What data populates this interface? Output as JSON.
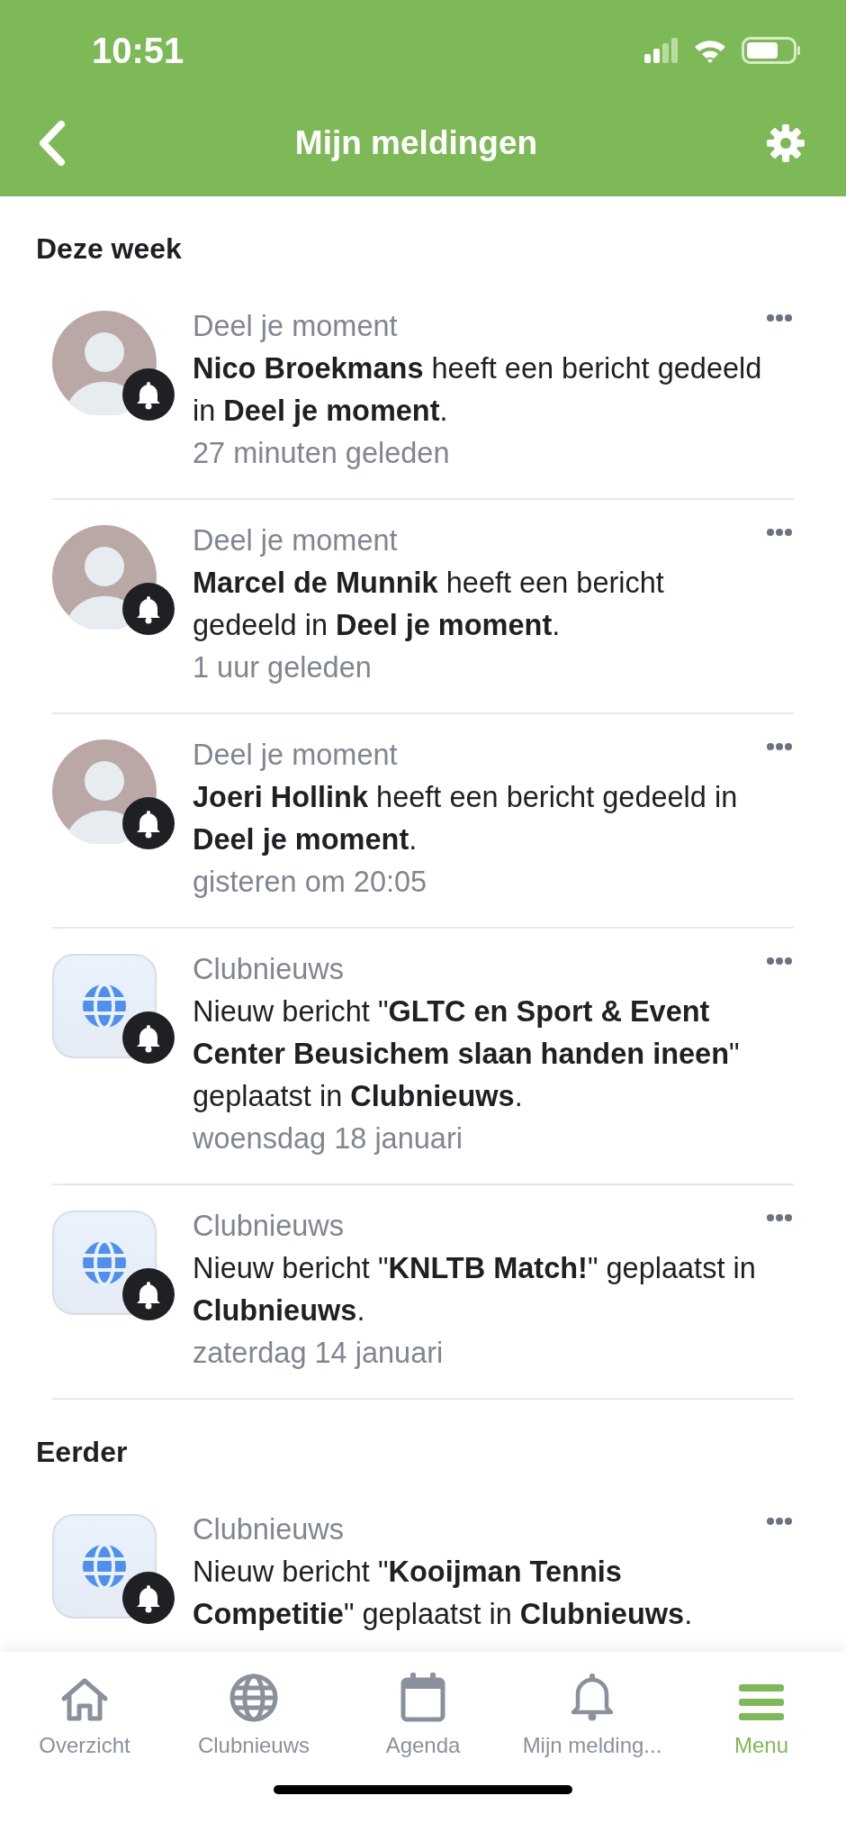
{
  "status_bar": {
    "time": "10:51"
  },
  "nav": {
    "title": "Mijn meldingen"
  },
  "sections": [
    {
      "title": "Deze week",
      "items": [
        {
          "kind": "person",
          "source": "Deel je moment",
          "message": "**Nico Broekmans** heeft een bericht gedeeld in **Deel je moment**.",
          "time": "27 minuten geleden"
        },
        {
          "kind": "person",
          "source": "Deel je moment",
          "message": "**Marcel de Munnik** heeft een bericht gedeeld in **Deel je moment**.",
          "time": "1 uur geleden"
        },
        {
          "kind": "person",
          "source": "Deel je moment",
          "message": "**Joeri Hollink** heeft een bericht gedeeld in **Deel je moment**.",
          "time": "gisteren om 20:05"
        },
        {
          "kind": "club",
          "source": "Clubnieuws",
          "message": "Nieuw bericht \"**GLTC en Sport & Event Center Beusichem slaan handen ineen**\" geplaatst in **Clubnieuws**.",
          "time": "woensdag 18 januari"
        },
        {
          "kind": "club",
          "source": "Clubnieuws",
          "message": "Nieuw bericht \"**KNLTB Match!**\" geplaatst in **Clubnieuws**.",
          "time": "zaterdag 14 januari"
        }
      ]
    },
    {
      "title": "Eerder",
      "items": [
        {
          "kind": "club",
          "source": "Clubnieuws",
          "message": "Nieuw bericht \"**Kooijman Tennis Competitie**\" geplaatst in **Clubnieuws**."
        }
      ]
    }
  ],
  "tabs": [
    {
      "label": "Overzicht",
      "selected": false
    },
    {
      "label": "Clubnieuws",
      "selected": false
    },
    {
      "label": "Agenda",
      "selected": false
    },
    {
      "label": "Mijn melding...",
      "selected": false
    },
    {
      "label": "Menu",
      "selected": true
    }
  ]
}
